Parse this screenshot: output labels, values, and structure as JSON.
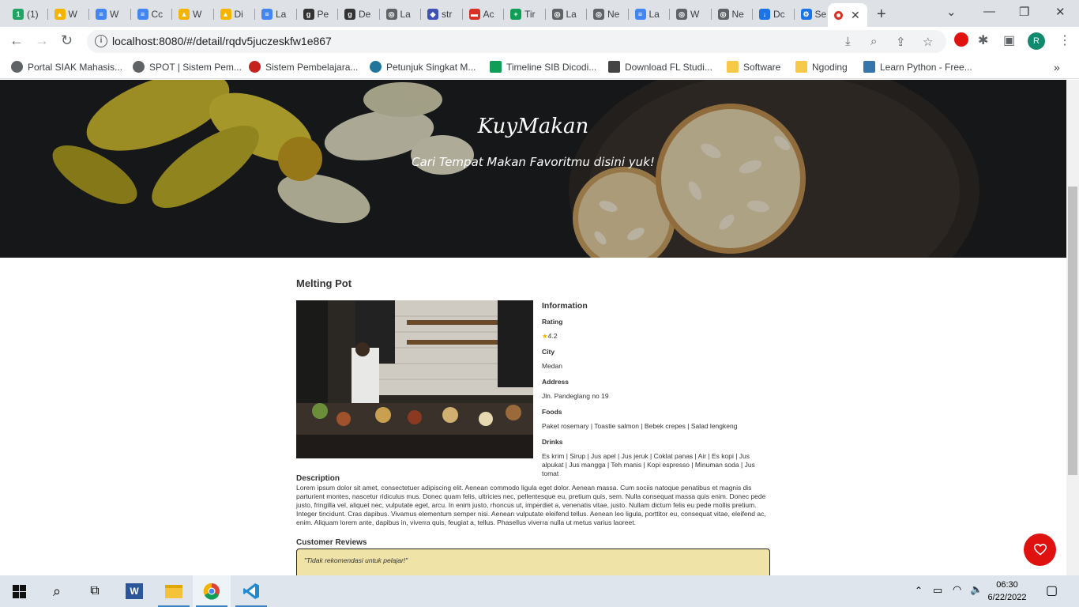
{
  "browser": {
    "tabs": [
      {
        "label": "(1)",
        "color": "#1fa463",
        "glyph": "1"
      },
      {
        "label": "W",
        "color": "#f5b400",
        "glyph": "▲"
      },
      {
        "label": "W",
        "color": "#4285f4",
        "glyph": "≡"
      },
      {
        "label": "Cc",
        "color": "#4285f4",
        "glyph": "≡"
      },
      {
        "label": "W",
        "color": "#f5b400",
        "glyph": "▲"
      },
      {
        "label": "Di",
        "color": "#f5b400",
        "glyph": "▲"
      },
      {
        "label": "La",
        "color": "#4285f4",
        "glyph": "≡"
      },
      {
        "label": "Pe",
        "color": "#333333",
        "glyph": "g"
      },
      {
        "label": "De",
        "color": "#333333",
        "glyph": "g"
      },
      {
        "label": "La",
        "color": "#5f6368",
        "glyph": "◎"
      },
      {
        "label": "str",
        "color": "#3f51b5",
        "glyph": "◆"
      },
      {
        "label": "Ac",
        "color": "#d93025",
        "glyph": "▬"
      },
      {
        "label": "Tir",
        "color": "#0f9d58",
        "glyph": "+"
      },
      {
        "label": "La",
        "color": "#5f6368",
        "glyph": "◎"
      },
      {
        "label": "Ne",
        "color": "#5f6368",
        "glyph": "◎"
      },
      {
        "label": "La",
        "color": "#4285f4",
        "glyph": "≡"
      },
      {
        "label": "W",
        "color": "#5f6368",
        "glyph": "◎"
      },
      {
        "label": "Ne",
        "color": "#5f6368",
        "glyph": "◎"
      },
      {
        "label": "Dc",
        "color": "#1a73e8",
        "glyph": "↓"
      },
      {
        "label": "Se",
        "color": "#1a73e8",
        "glyph": "⚙"
      }
    ],
    "url": "localhost:8080/#/detail/rqdv5juczeskfw1e867",
    "profile_initial": "R",
    "bookmarks": [
      {
        "label": "Portal SIAK Mahasis...",
        "color": "#5f6368"
      },
      {
        "label": "SPOT | Sistem Pem...",
        "color": "#5f6368"
      },
      {
        "label": "Sistem Pembelajara...",
        "color": "#c5221f"
      },
      {
        "label": "Petunjuk Singkat M...",
        "color": "#21759b"
      },
      {
        "label": "Timeline SIB Dicodi...",
        "color": "#0f9d58"
      },
      {
        "label": "Download FL Studi...",
        "color": "#444444"
      },
      {
        "label": "Software",
        "color": "#f7c948"
      },
      {
        "label": "Ngoding",
        "color": "#f7c948"
      },
      {
        "label": "Learn Python - Free...",
        "color": "#3776ab"
      }
    ]
  },
  "hero": {
    "title": "KuyMakan",
    "subtitle": "Cari Tempat Makan Favoritmu disini yuk!"
  },
  "restaurant": {
    "name": "Melting Pot",
    "info_heading": "Information",
    "rating_label": "Rating",
    "rating_value": "4.2",
    "city_label": "City",
    "city_value": "Medan",
    "address_label": "Address",
    "address_value": "Jln. Pandeglang no 19",
    "foods_label": "Foods",
    "foods_value": "Paket rosemary | Toastie salmon | Bebek crepes | Salad lengkeng",
    "drinks_label": "Drinks",
    "drinks_value": "Es krim | Sirup | Jus apel | Jus jeruk | Coklat panas | Air | Es kopi | Jus alpukat | Jus mangga | Teh manis | Kopi espresso | Minuman soda | Jus tomat",
    "description_label": "Description",
    "description": "Lorem ipsum dolor sit amet, consectetuer adipiscing elit. Aenean commodo ligula eget dolor. Aenean massa. Cum sociis natoque penatibus et magnis dis parturient montes, nascetur ridiculus mus. Donec quam felis, ultricies nec, pellentesque eu, pretium quis, sem. Nulla consequat massa quis enim. Donec pede justo, fringilla vel, aliquet nec, vulputate eget, arcu. In enim justo, rhoncus ut, imperdiet a, venenatis vitae, justo. Nullam dictum felis eu pede mollis pretium. Integer tincidunt. Cras dapibus. Vivamus elementum semper nisi. Aenean vulputate eleifend tellus. Aenean leo ligula, porttitor eu, consequat vitae, eleifend ac, enim. Aliquam lorem ante, dapibus in, viverra quis, feugiat a, tellus. Phasellus viverra nulla ut metus varius laoreet.",
    "reviews_label": "Customer Reviews",
    "reviews": [
      "\"Tidak rekomendasi untuk pelajar!\""
    ]
  },
  "colors": {
    "favorite_button": "#e0120f",
    "review_background": "#efe3a7"
  },
  "taskbar": {
    "time": "06:30",
    "date": "6/22/2022"
  }
}
